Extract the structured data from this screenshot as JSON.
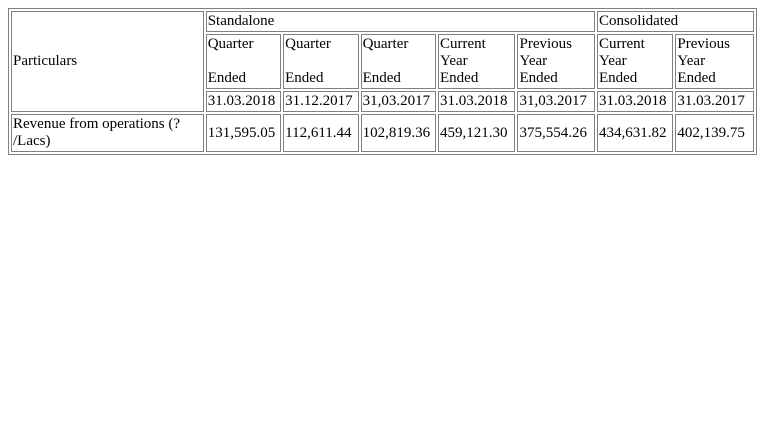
{
  "table": {
    "particulars_header": "Particulars",
    "groups": {
      "standalone": "Standalone",
      "consolidated": "Consolidated"
    },
    "columns": [
      {
        "lines": [
          "Quarter",
          "Ended"
        ],
        "date": "31.03.2018"
      },
      {
        "lines": [
          "Quarter",
          "Ended"
        ],
        "date": "31.12.2017"
      },
      {
        "lines": [
          "Quarter",
          "Ended"
        ],
        "date": "31,03.2017"
      },
      {
        "lines": [
          "Current",
          "Year",
          "Ended"
        ],
        "date": "31.03.2018"
      },
      {
        "lines": [
          "Previous",
          "Year",
          "Ended"
        ],
        "date": "31,03.2017"
      },
      {
        "lines": [
          "Current",
          "Year",
          "Ended"
        ],
        "date": "31.03.2018"
      },
      {
        "lines": [
          "Previous",
          "Year",
          "Ended"
        ],
        "date": "31.03.2017"
      }
    ],
    "rows": [
      {
        "label": "Revenue from operations (? /Lacs)",
        "values": [
          "131,595.05",
          "112,611.44",
          "102,819.36",
          "459,121.30",
          "375,554.26",
          "434,631.82",
          "402,139.75"
        ]
      }
    ]
  }
}
